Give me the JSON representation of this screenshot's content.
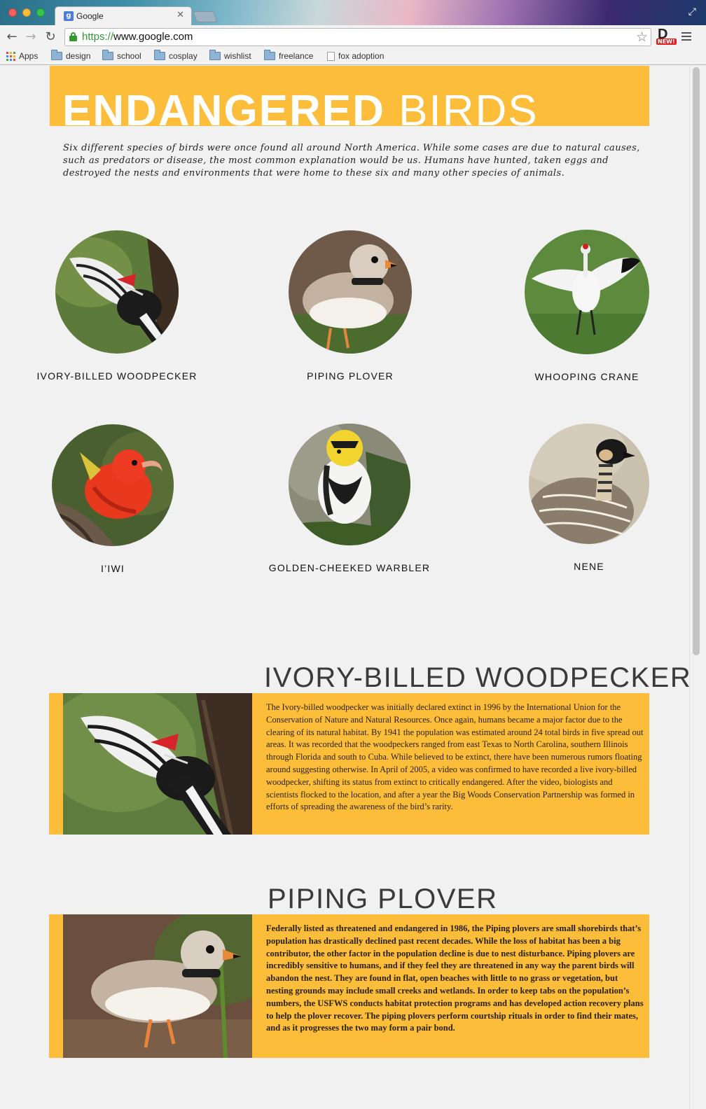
{
  "browser": {
    "tab_title": "Google",
    "url_scheme": "https://",
    "url_host": "www.google.com",
    "extension_badge": "NEW!",
    "bookmarks": [
      {
        "label": "Apps",
        "icon": "apps-grid-icon"
      },
      {
        "label": "design",
        "icon": "folder-icon"
      },
      {
        "label": "school",
        "icon": "folder-icon"
      },
      {
        "label": "cosplay",
        "icon": "folder-icon"
      },
      {
        "label": "wishlist",
        "icon": "folder-icon"
      },
      {
        "label": "freelance",
        "icon": "folder-icon"
      },
      {
        "label": "fox adoption",
        "icon": "page-icon"
      }
    ]
  },
  "hero": {
    "title_bold": "ENDANGERED",
    "title_light": "BIRDS",
    "intro": "Six different species of birds were once found all around North America. While some cases are due to natural causes, such as predators or disease, the most common explanation would be us. Humans have hunted, taken eggs and destroyed the nests and environments that were home to these six and many other species of animals."
  },
  "birds": [
    {
      "name": "IVORY-BILLED WOODPECKER"
    },
    {
      "name": "PIPING PLOVER"
    },
    {
      "name": "WHOOPING CRANE"
    },
    {
      "name": "I’IWI"
    },
    {
      "name": "GOLDEN-CHEEKED WARBLER"
    },
    {
      "name": "NENE"
    }
  ],
  "sections": [
    {
      "title": "IVORY-BILLED WOODPECKER",
      "text": "The Ivory-billed woodpecker was initially declared extinct in 1996 by the International Union for the Conservation of Nature and Natural Resources. Once again, humans became a major factor due to the clearing of its natural habitat. By 1941 the population was estimated around 24 total birds in five spread out areas. It was recorded that the woodpeckers ranged from east Texas to North Carolina, southern Illinois through Florida and south to Cuba. While believed to be extinct, there have been numerous rumors floating around suggesting otherwise. In April of 2005, a video was confirmed to have recorded a live ivory-billed woodpecker, shifting its status from extinct to critically endangered. After the video, biologists and scientists flocked to the location, and after a year the Big Woods Conservation Partnership was formed in efforts of spreading the awareness of the bird’s rarity."
    },
    {
      "title": "PIPING PLOVER",
      "text": "Federally listed as threatened and endangered in 1986, the Piping plovers are small shorebirds that’s population has drastically declined past recent decades. While the loss of habitat has been a big contributor, the other factor in the population decline is due to nest disturbance. Piping plovers are incredibly sensitive to humans, and if they feel they are threatened in any way the parent birds will abandon the nest. They are found in flat, open beaches with little to no grass or vegetation, but nesting grounds may include small creeks and wetlands. In order to keep tabs on the population’s numbers, the USFWS conducts habitat protection programs and has developed action recovery plans to help the plover recover. The piping plovers perform courtship rituals in order to find their mates, and as it progresses the two may form a pair bond."
    }
  ],
  "colors": {
    "accent": "#fcbd3a",
    "page_bg": "#f1f1f1",
    "heading": "#3a3a3a"
  }
}
